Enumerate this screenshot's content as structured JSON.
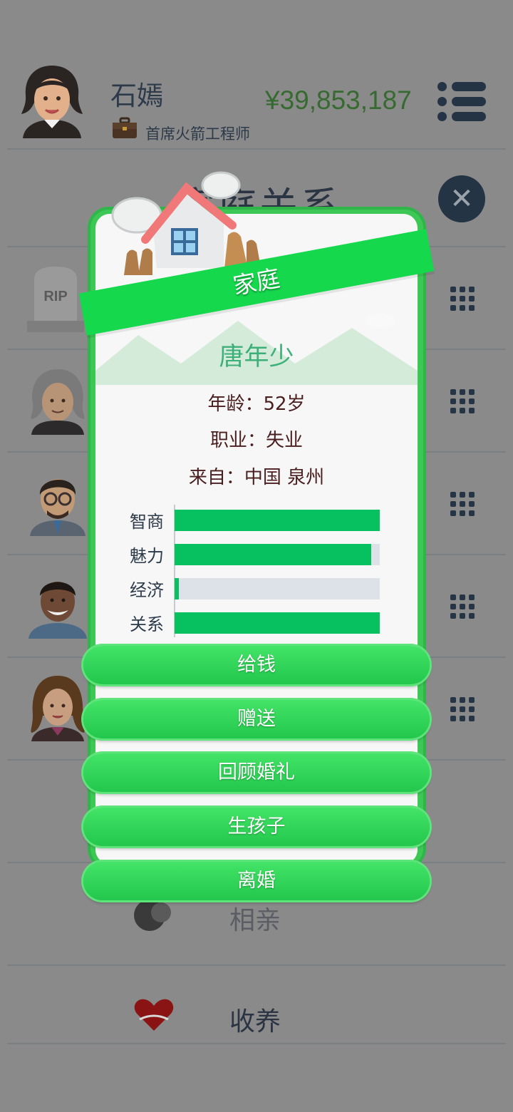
{
  "header": {
    "user_name": "石嫣",
    "job_title": "首席火箭工程师",
    "money": "¥39,853,187"
  },
  "page": {
    "title": "家庭关系",
    "actions": [
      {
        "label": "相亲"
      },
      {
        "label": "收养"
      }
    ]
  },
  "modal": {
    "banner": "家庭",
    "name": "唐年少",
    "age": "年龄：52岁",
    "occupation": "职业：失业",
    "origin": "来自：中国 泉州",
    "stats": [
      {
        "label": "智商",
        "value": 1.0
      },
      {
        "label": "魅力",
        "value": 0.96
      },
      {
        "label": "经济",
        "value": 0.02
      },
      {
        "label": "关系",
        "value": 1.0
      }
    ],
    "buttons": [
      {
        "label": "给钱"
      },
      {
        "label": "赠送"
      },
      {
        "label": "回顾婚礼"
      },
      {
        "label": "生孩子"
      },
      {
        "label": "离婚"
      }
    ]
  },
  "colors": {
    "accent_green": "#07c160",
    "frame_green": "#3dc856",
    "money_green": "#366a31",
    "name_teal": "#3cb078"
  },
  "icons": [
    "user-avatar-icon",
    "briefcase-icon",
    "menu-icon",
    "close-icon",
    "grid-icon",
    "rip-tombstone-icon",
    "house-icon",
    "blind-date-icon",
    "adopt-heart-icon"
  ]
}
